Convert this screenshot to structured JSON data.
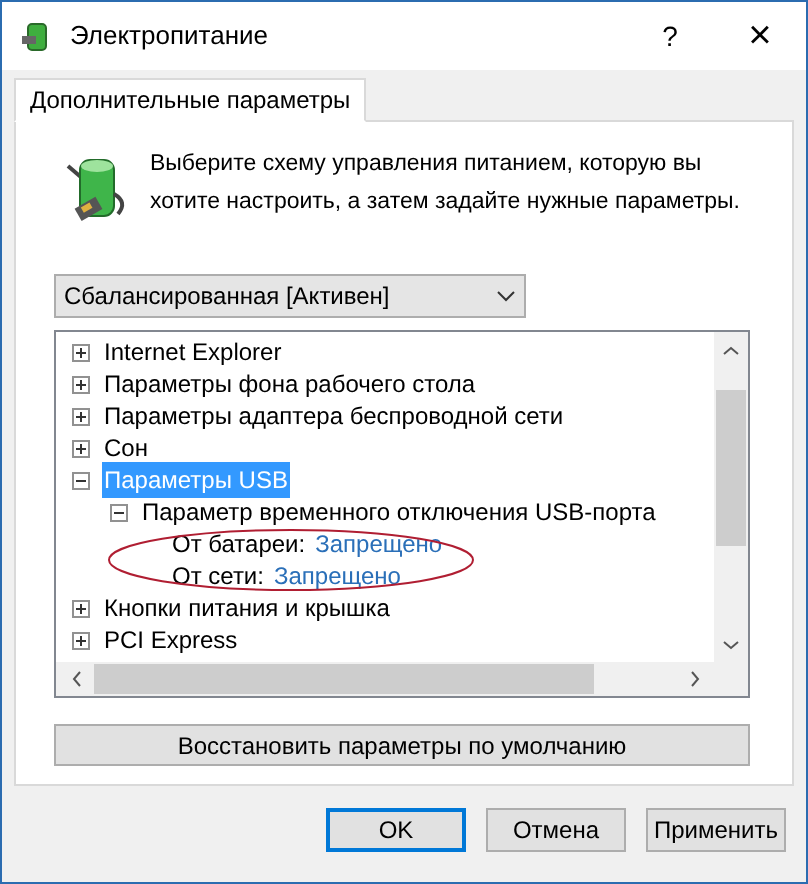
{
  "window": {
    "title": "Электропитание",
    "help": "?",
    "close": "×"
  },
  "tabs": [
    {
      "label": "Дополнительные параметры",
      "selected": true
    }
  ],
  "description": "Выберите схему управления питанием, которую вы хотите настроить, а затем задайте нужные параметры.",
  "plan_select": {
    "value": "Сбалансированная [Активен]"
  },
  "tree": [
    {
      "label": "Internet Explorer",
      "expanded": false,
      "selected": false
    },
    {
      "label": "Параметры фона рабочего стола",
      "expanded": false,
      "selected": false
    },
    {
      "label": "Параметры адаптера беспроводной сети",
      "expanded": false,
      "selected": false
    },
    {
      "label": "Сон",
      "expanded": false,
      "selected": false
    },
    {
      "label": "Параметры USB",
      "expanded": true,
      "selected": true,
      "children": [
        {
          "label": "Параметр временного отключения USB-порта",
          "expanded": true,
          "selected": false,
          "children": [
            {
              "kind": "setting",
              "label": "От батареи:",
              "value": "Запрещено"
            },
            {
              "kind": "setting",
              "label": "От сети:",
              "value": "Запрещено"
            }
          ]
        }
      ]
    },
    {
      "label": "Кнопки питания и крышка",
      "expanded": false,
      "selected": false
    },
    {
      "label": "PCI Express",
      "expanded": false,
      "selected": false
    }
  ],
  "restore_button": "Восстановить параметры по умолчанию",
  "buttons": [
    {
      "label": "OK",
      "default": true
    },
    {
      "label": "Отмена",
      "default": false
    },
    {
      "label": "Применить",
      "default": false
    }
  ]
}
